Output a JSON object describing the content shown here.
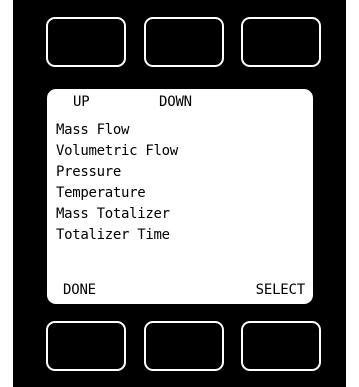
{
  "screen": {
    "nav": {
      "up_label": "UP",
      "down_label": "DOWN"
    },
    "menu_items": [
      "Mass Flow",
      "Volumetric Flow",
      "Pressure",
      "Temperature",
      "Mass Totalizer",
      "Totalizer Time"
    ],
    "footer": {
      "done_label": "DONE",
      "select_label": "SELECT"
    }
  },
  "colors": {
    "bezel": "#000000",
    "screen_background": "#ffffff",
    "text": "#000000",
    "button_outline": "#ffffff"
  }
}
